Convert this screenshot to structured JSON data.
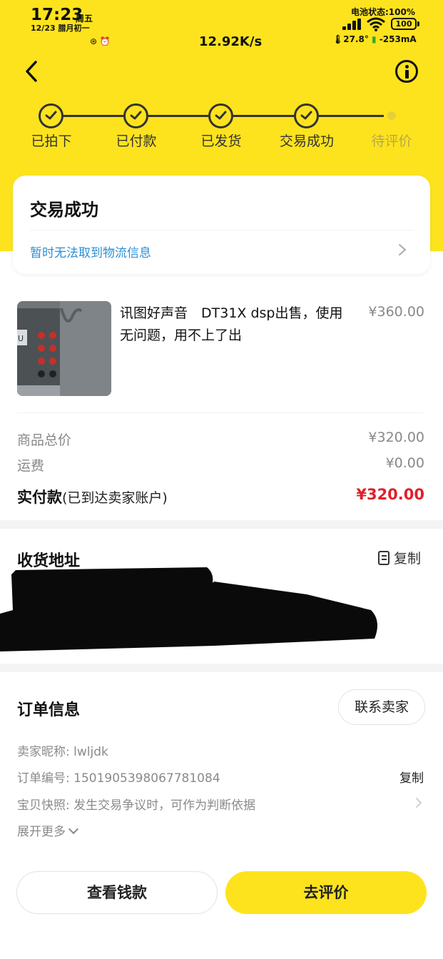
{
  "status_bar": {
    "time": "17:23",
    "weekday": "周五",
    "date": "12/23 腊月初一",
    "speed": "12.92K/s",
    "battery_label": "电池状态:100%",
    "battery_level": "100",
    "temperature": "27.8°",
    "current": "-253mA"
  },
  "steps": [
    {
      "label": "已拍下",
      "done": true
    },
    {
      "label": "已付款",
      "done": true
    },
    {
      "label": "已发货",
      "done": true
    },
    {
      "label": "交易成功",
      "done": true
    },
    {
      "label": "待评价",
      "done": false
    }
  ],
  "status_card": {
    "title": "交易成功",
    "logistics_text": "暂时无法取到物流信息"
  },
  "product": {
    "title": "讯图好声音　DT31X dsp出售，使用无问题，用不上了出",
    "price": "¥360.00"
  },
  "summary": {
    "goods_total_label": "商品总价",
    "goods_total_value": "¥320.00",
    "shipping_label": "运费",
    "shipping_value": "¥0.00",
    "paid_label": "实付款",
    "paid_sub": "(已到达卖家账户)",
    "paid_value": "¥320.00"
  },
  "address": {
    "title": "收货地址",
    "copy_label": "复制"
  },
  "order_info": {
    "title": "订单信息",
    "contact_label": "联系卖家",
    "seller_row": "卖家昵称: lwljdk",
    "order_no_row": "订单编号: 1501905398067781084",
    "copy_label": "复制",
    "snapshot_row": "宝贝快照: 发生交易争议时，可作为判断依据",
    "expand_label": "展开更多"
  },
  "actions": {
    "view_funds": "查看钱款",
    "review": "去评价"
  },
  "colors": {
    "brand_yellow": "#fde31d",
    "price_red": "#e0202b",
    "link_blue": "#2b8fd6"
  }
}
